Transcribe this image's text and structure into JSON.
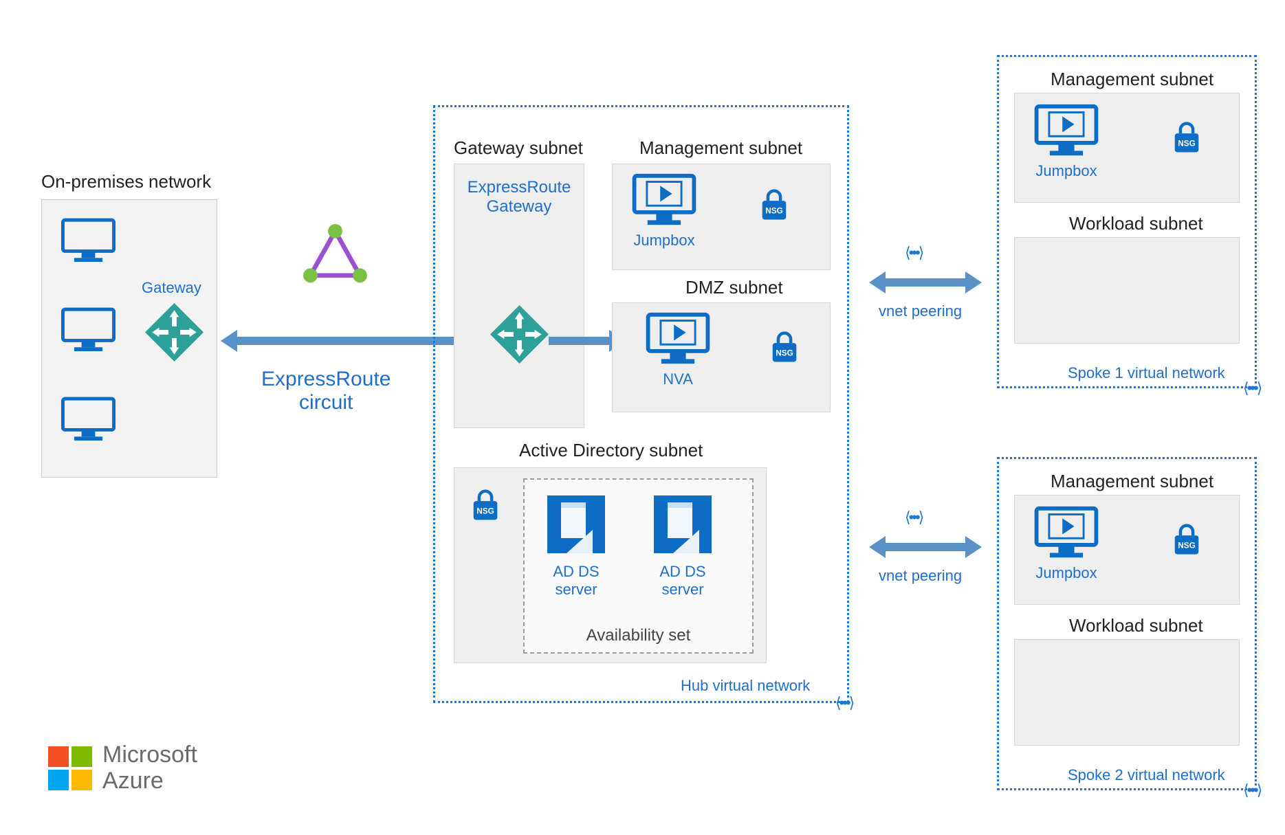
{
  "onprem": {
    "title": "On-premises network",
    "gateway_label": "Gateway"
  },
  "circuit": {
    "label": "ExpressRoute\ncircuit"
  },
  "hub": {
    "label": "Hub virtual network",
    "gateway_subnet": {
      "title": "Gateway subnet",
      "gateway_label": "ExpressRoute\nGateway"
    },
    "management_subnet": {
      "title": "Management subnet",
      "jumpbox": "Jumpbox",
      "nsg": "NSG"
    },
    "dmz_subnet": {
      "title": "DMZ subnet",
      "nva": "NVA",
      "nsg": "NSG"
    },
    "ad_subnet": {
      "title": "Active Directory subnet",
      "nsg": "NSG",
      "availability_set": "Availability set",
      "server1": "AD DS\nserver",
      "server2": "AD DS\nserver"
    }
  },
  "peering": {
    "label": "vnet peering"
  },
  "spoke1": {
    "label": "Spoke 1 virtual network",
    "management_subnet": {
      "title": "Management subnet",
      "jumpbox": "Jumpbox",
      "nsg": "NSG"
    },
    "workload_subnet": {
      "title": "Workload subnet"
    }
  },
  "spoke2": {
    "label": "Spoke 2 virtual network",
    "management_subnet": {
      "title": "Management subnet",
      "jumpbox": "Jumpbox",
      "nsg": "NSG"
    },
    "workload_subnet": {
      "title": "Workload subnet"
    }
  },
  "branding": {
    "line1": "Microsoft",
    "line2": "Azure"
  }
}
